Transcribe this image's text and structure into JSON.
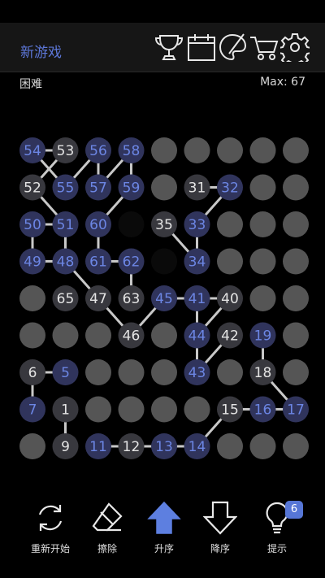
{
  "header": {
    "new_game_label": "新游戏",
    "icons": [
      "trophy-icon",
      "calendar-icon",
      "palette-icon",
      "cart-icon",
      "gear-icon"
    ]
  },
  "status": {
    "difficulty": "困难",
    "max_label": "Max: 67"
  },
  "colors": {
    "accent": "#5d77d8",
    "selected_text": "#6c86e4",
    "cell_dark": "#38383e",
    "cell_blue": "#30345c",
    "cell_grey": "#555555",
    "line": "#c8c8c8"
  },
  "board": {
    "rows": 9,
    "cols": 9,
    "cells": [
      {
        "r": 0,
        "c": 0,
        "n": "54",
        "blue": true
      },
      {
        "r": 0,
        "c": 1,
        "n": "53",
        "blue": false
      },
      {
        "r": 0,
        "c": 2,
        "n": "56",
        "blue": true
      },
      {
        "r": 0,
        "c": 3,
        "n": "58",
        "blue": true
      },
      {
        "r": 1,
        "c": 0,
        "n": "52",
        "blue": false
      },
      {
        "r": 1,
        "c": 1,
        "n": "55",
        "blue": true
      },
      {
        "r": 1,
        "c": 2,
        "n": "57",
        "blue": true
      },
      {
        "r": 1,
        "c": 3,
        "n": "59",
        "blue": true
      },
      {
        "r": 1,
        "c": 5,
        "n": "31",
        "blue": false
      },
      {
        "r": 1,
        "c": 6,
        "n": "32",
        "blue": true
      },
      {
        "r": 2,
        "c": 0,
        "n": "50",
        "blue": true
      },
      {
        "r": 2,
        "c": 1,
        "n": "51",
        "blue": true
      },
      {
        "r": 2,
        "c": 2,
        "n": "60",
        "blue": true
      },
      {
        "r": 2,
        "c": 4,
        "n": "35",
        "blue": false
      },
      {
        "r": 2,
        "c": 5,
        "n": "33",
        "blue": true
      },
      {
        "r": 3,
        "c": 0,
        "n": "49",
        "blue": true
      },
      {
        "r": 3,
        "c": 1,
        "n": "48",
        "blue": true
      },
      {
        "r": 3,
        "c": 2,
        "n": "61",
        "blue": true
      },
      {
        "r": 3,
        "c": 3,
        "n": "62",
        "blue": true
      },
      {
        "r": 3,
        "c": 5,
        "n": "34",
        "blue": true
      },
      {
        "r": 4,
        "c": 1,
        "n": "65",
        "blue": false
      },
      {
        "r": 4,
        "c": 2,
        "n": "47",
        "blue": false
      },
      {
        "r": 4,
        "c": 3,
        "n": "63",
        "blue": false
      },
      {
        "r": 4,
        "c": 4,
        "n": "45",
        "blue": true
      },
      {
        "r": 4,
        "c": 5,
        "n": "41",
        "blue": true
      },
      {
        "r": 4,
        "c": 6,
        "n": "40",
        "blue": false
      },
      {
        "r": 5,
        "c": 3,
        "n": "46",
        "blue": false
      },
      {
        "r": 5,
        "c": 5,
        "n": "44",
        "blue": true
      },
      {
        "r": 5,
        "c": 6,
        "n": "42",
        "blue": false
      },
      {
        "r": 5,
        "c": 7,
        "n": "19",
        "blue": true
      },
      {
        "r": 6,
        "c": 0,
        "n": "6",
        "blue": false
      },
      {
        "r": 6,
        "c": 1,
        "n": "5",
        "blue": true
      },
      {
        "r": 6,
        "c": 5,
        "n": "43",
        "blue": true
      },
      {
        "r": 6,
        "c": 7,
        "n": "18",
        "blue": false
      },
      {
        "r": 7,
        "c": 0,
        "n": "7",
        "blue": true
      },
      {
        "r": 7,
        "c": 1,
        "n": "1",
        "blue": false
      },
      {
        "r": 7,
        "c": 6,
        "n": "15",
        "blue": false
      },
      {
        "r": 7,
        "c": 7,
        "n": "16",
        "blue": true
      },
      {
        "r": 7,
        "c": 8,
        "n": "17",
        "blue": true
      },
      {
        "r": 8,
        "c": 1,
        "n": "9",
        "blue": false
      },
      {
        "r": 8,
        "c": 2,
        "n": "11",
        "blue": true
      },
      {
        "r": 8,
        "c": 3,
        "n": "12",
        "blue": false
      },
      {
        "r": 8,
        "c": 4,
        "n": "13",
        "blue": true
      },
      {
        "r": 8,
        "c": 5,
        "n": "14",
        "blue": true
      }
    ],
    "grey_cells": [
      {
        "r": 0,
        "c": 4
      },
      {
        "r": 0,
        "c": 5
      },
      {
        "r": 0,
        "c": 6
      },
      {
        "r": 0,
        "c": 7
      },
      {
        "r": 0,
        "c": 8
      },
      {
        "r": 1,
        "c": 4
      },
      {
        "r": 1,
        "c": 7
      },
      {
        "r": 1,
        "c": 8
      },
      {
        "r": 2,
        "c": 6
      },
      {
        "r": 2,
        "c": 7
      },
      {
        "r": 2,
        "c": 8
      },
      {
        "r": 3,
        "c": 6
      },
      {
        "r": 3,
        "c": 7
      },
      {
        "r": 3,
        "c": 8
      },
      {
        "r": 4,
        "c": 0
      },
      {
        "r": 4,
        "c": 7
      },
      {
        "r": 4,
        "c": 8
      },
      {
        "r": 5,
        "c": 0
      },
      {
        "r": 5,
        "c": 1
      },
      {
        "r": 5,
        "c": 2
      },
      {
        "r": 5,
        "c": 4
      },
      {
        "r": 5,
        "c": 8
      },
      {
        "r": 6,
        "c": 2
      },
      {
        "r": 6,
        "c": 3
      },
      {
        "r": 6,
        "c": 4
      },
      {
        "r": 6,
        "c": 6
      },
      {
        "r": 6,
        "c": 8
      },
      {
        "r": 7,
        "c": 2
      },
      {
        "r": 7,
        "c": 3
      },
      {
        "r": 7,
        "c": 4
      },
      {
        "r": 7,
        "c": 5
      },
      {
        "r": 8,
        "c": 0
      },
      {
        "r": 8,
        "c": 6
      },
      {
        "r": 8,
        "c": 7
      },
      {
        "r": 8,
        "c": 8
      }
    ],
    "black_cells": [
      {
        "r": 1,
        "c": 2
      },
      {
        "r": 2,
        "c": 3
      },
      {
        "r": 3,
        "c": 4
      }
    ],
    "links": [
      [
        [
          0,
          0
        ],
        [
          0,
          1
        ]
      ],
      [
        [
          0,
          0
        ],
        [
          1,
          1
        ]
      ],
      [
        [
          0,
          1
        ],
        [
          1,
          0
        ]
      ],
      [
        [
          0,
          2
        ],
        [
          1,
          1
        ]
      ],
      [
        [
          0,
          2
        ],
        [
          1,
          2
        ]
      ],
      [
        [
          0,
          3
        ],
        [
          1,
          2
        ]
      ],
      [
        [
          0,
          3
        ],
        [
          1,
          3
        ]
      ],
      [
        [
          1,
          3
        ],
        [
          2,
          2
        ]
      ],
      [
        [
          1,
          0
        ],
        [
          2,
          1
        ]
      ],
      [
        [
          2,
          0
        ],
        [
          2,
          1
        ]
      ],
      [
        [
          2,
          0
        ],
        [
          3,
          0
        ]
      ],
      [
        [
          3,
          0
        ],
        [
          3,
          1
        ]
      ],
      [
        [
          3,
          1
        ],
        [
          2,
          1
        ]
      ],
      [
        [
          3,
          1
        ],
        [
          4,
          2
        ]
      ],
      [
        [
          2,
          2
        ],
        [
          3,
          2
        ]
      ],
      [
        [
          3,
          2
        ],
        [
          3,
          3
        ]
      ],
      [
        [
          3,
          3
        ],
        [
          4,
          3
        ]
      ],
      [
        [
          4,
          2
        ],
        [
          5,
          3
        ]
      ],
      [
        [
          5,
          3
        ],
        [
          4,
          4
        ]
      ],
      [
        [
          4,
          4
        ],
        [
          4,
          5
        ]
      ],
      [
        [
          4,
          5
        ],
        [
          4,
          6
        ]
      ],
      [
        [
          4,
          5
        ],
        [
          5,
          5
        ]
      ],
      [
        [
          4,
          6
        ],
        [
          5,
          5
        ]
      ],
      [
        [
          5,
          5
        ],
        [
          6,
          5
        ]
      ],
      [
        [
          6,
          5
        ],
        [
          5,
          6
        ]
      ],
      [
        [
          1,
          5
        ],
        [
          1,
          6
        ]
      ],
      [
        [
          1,
          6
        ],
        [
          2,
          5
        ]
      ],
      [
        [
          2,
          4
        ],
        [
          3,
          5
        ]
      ],
      [
        [
          2,
          5
        ],
        [
          3,
          5
        ]
      ],
      [
        [
          5,
          7
        ],
        [
          6,
          7
        ]
      ],
      [
        [
          6,
          7
        ],
        [
          7,
          8
        ]
      ],
      [
        [
          7,
          6
        ],
        [
          7,
          7
        ]
      ],
      [
        [
          7,
          7
        ],
        [
          7,
          8
        ]
      ],
      [
        [
          7,
          6
        ],
        [
          8,
          5
        ]
      ],
      [
        [
          6,
          0
        ],
        [
          6,
          1
        ]
      ],
      [
        [
          6,
          0
        ],
        [
          7,
          0
        ]
      ],
      [
        [
          7,
          1
        ],
        [
          8,
          1
        ]
      ],
      [
        [
          8,
          2
        ],
        [
          8,
          3
        ]
      ],
      [
        [
          8,
          3
        ],
        [
          8,
          4
        ]
      ],
      [
        [
          8,
          4
        ],
        [
          8,
          5
        ]
      ]
    ]
  },
  "toolbar": {
    "restart_label": "重新开始",
    "erase_label": "擦除",
    "ascending_label": "升序",
    "descending_label": "降序",
    "hint_label": "提示",
    "hint_count": "6"
  }
}
